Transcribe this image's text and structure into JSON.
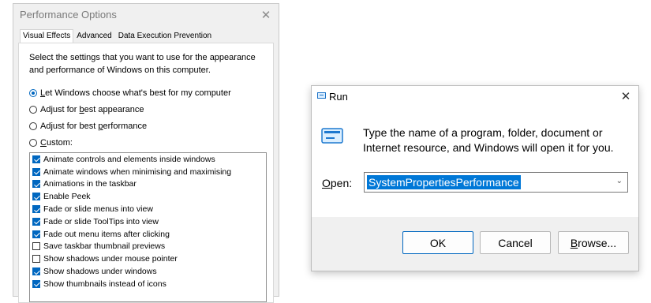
{
  "perf_window": {
    "title": "Performance Options",
    "close_glyph": "✕",
    "tabs": [
      "Visual Effects",
      "Advanced",
      "Data Execution Prevention"
    ],
    "description": "Select the settings that you want to use for the appearance and performance of Windows on this computer.",
    "radios": [
      {
        "pre": "",
        "mn": "L",
        "post": "et Windows choose what's best for my computer",
        "checked": true
      },
      {
        "pre": "Adjust for ",
        "mn": "b",
        "post": "est appearance",
        "checked": false
      },
      {
        "pre": "Adjust for best ",
        "mn": "p",
        "post": "erformance",
        "checked": false
      },
      {
        "pre": "",
        "mn": "C",
        "post": "ustom:",
        "checked": false
      }
    ],
    "effects": [
      {
        "label": "Animate controls and elements inside windows",
        "checked": true
      },
      {
        "label": "Animate windows when minimising and maximising",
        "checked": true
      },
      {
        "label": "Animations in the taskbar",
        "checked": true
      },
      {
        "label": "Enable Peek",
        "checked": true
      },
      {
        "label": "Fade or slide menus into view",
        "checked": true
      },
      {
        "label": "Fade or slide ToolTips into view",
        "checked": true
      },
      {
        "label": "Fade out menu items after clicking",
        "checked": true
      },
      {
        "label": "Save taskbar thumbnail previews",
        "checked": false
      },
      {
        "label": "Show shadows under mouse pointer",
        "checked": false
      },
      {
        "label": "Show shadows under windows",
        "checked": true
      },
      {
        "label": "Show thumbnails instead of icons",
        "checked": true
      }
    ]
  },
  "run_dialog": {
    "title": "Run",
    "close_glyph": "✕",
    "prompt": "Type the name of a program, folder, document or Internet resource, and Windows will open it for you.",
    "open_label_mn": "O",
    "open_label_rest": "pen:",
    "open_value": "SystemPropertiesPerformance",
    "dropdown_glyph": "⌄",
    "ok_label": "OK",
    "cancel_label": "Cancel",
    "browse_pre": "",
    "browse_mn": "B",
    "browse_post": "rowse..."
  },
  "colors": {
    "accent": "#0067c0",
    "selection": "#0078d7"
  },
  "icons": [
    "close-icon",
    "run-app-icon",
    "dropdown-arrow-icon"
  ]
}
